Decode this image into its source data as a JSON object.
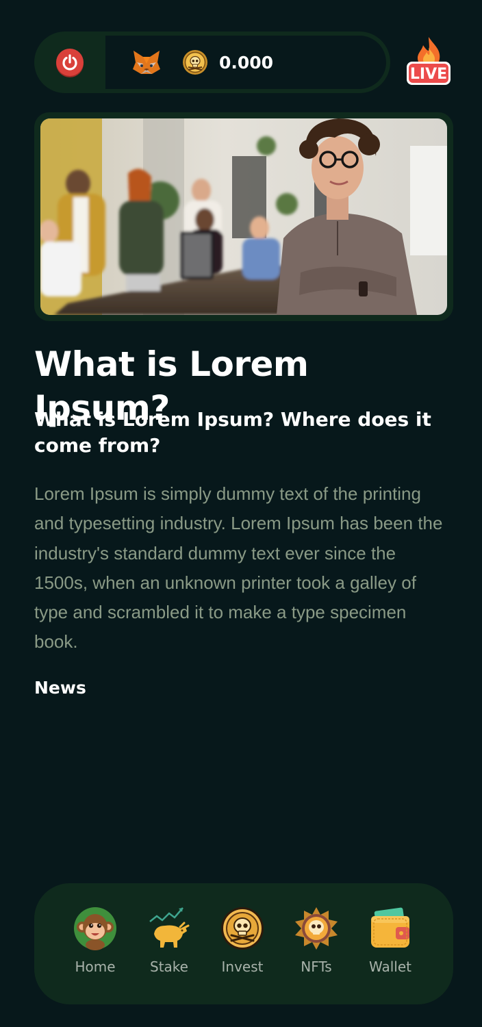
{
  "header": {
    "balance": "0.000",
    "icons": {
      "power": "power-icon",
      "wallet_provider": "metamask-fox-icon",
      "token": "skull-coin-icon",
      "live": "live-fire-icon"
    },
    "live_badge_text": "LIVE"
  },
  "hero": {
    "image": "team-office-photo"
  },
  "content": {
    "title": "What is Lorem Ipsum?",
    "subtitle": "What is Lorem Ipsum? Where does it come from?",
    "body": "Lorem Ipsum is simply dummy text of the printing and typesetting industry. Lorem Ipsum has been the industry's standard dummy text ever since the 1500s, when an unknown printer took a galley of type and scrambled it to make a type specimen book.",
    "section_label": "News"
  },
  "bottom_nav": {
    "items": [
      {
        "label": "Home",
        "icon": "monkey-icon"
      },
      {
        "label": "Stake",
        "icon": "bull-chart-icon"
      },
      {
        "label": "Invest",
        "icon": "skull-coin-icon"
      },
      {
        "label": "NFTs",
        "icon": "skull-badge-icon"
      },
      {
        "label": "Wallet",
        "icon": "wallet-icon"
      }
    ]
  },
  "colors": {
    "background": "#07181b",
    "panel": "#0f2a1d",
    "accent_red": "#d9403a",
    "muted_text": "#8a9a86",
    "nav_text": "#a9b3ab"
  }
}
